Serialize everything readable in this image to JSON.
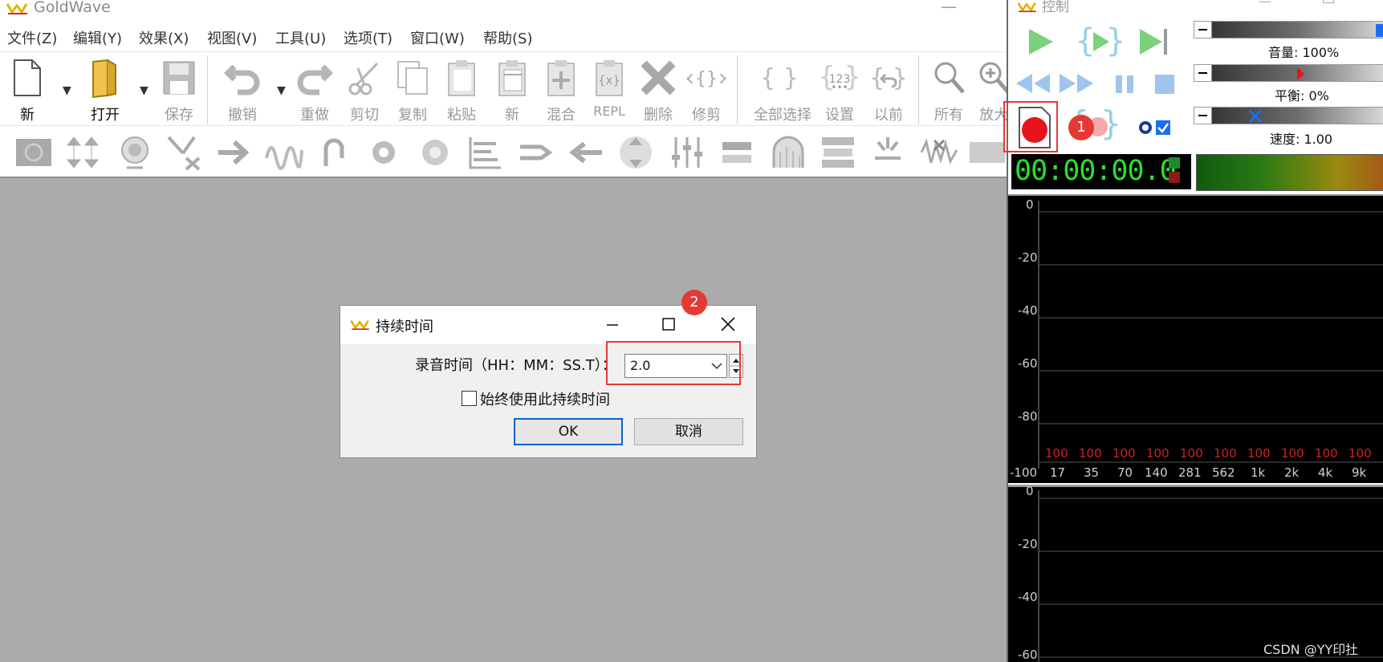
{
  "app": {
    "title": "GoldWave",
    "minimize_glyph": "—"
  },
  "menu": {
    "items": [
      "文件(Z)",
      "编辑(Y)",
      "效果(X)",
      "视图(V)",
      "工具(U)",
      "选项(T)",
      "窗口(W)",
      "帮助(S)"
    ]
  },
  "toolbar": {
    "new": "新",
    "open": "打开",
    "save": "保存",
    "undo": "撤销",
    "redo": "重做",
    "cut": "剪切",
    "copy": "复制",
    "paste": "粘贴",
    "paste_new": "新",
    "mix": "混合",
    "replace": "REPL",
    "delete": "删除",
    "trim": "修剪",
    "select_all": "全部选择",
    "set": "设置",
    "previous": "以前",
    "all": "所有",
    "zoom_in": "放大"
  },
  "dialog": {
    "title": "持续时间",
    "duration_label": "录音时间（HH：MM：SS.T）：",
    "duration_value": "2.0",
    "always_use_label": "始终使用此持续时间",
    "always_use_checked": false,
    "ok_label": "OK",
    "cancel_label": "取消"
  },
  "control": {
    "title": "控制",
    "volume_label": "音量: 100%",
    "volume_value": 1.0,
    "balance_label": "平衡: 0%",
    "balance_value": 0,
    "speed_label": "速度: 1.00",
    "speed_value": 1.0,
    "time_display": "00:00:00.0",
    "spectrum": {
      "db_ticks": [
        "0",
        "-20",
        "-40",
        "-60",
        "-80",
        "-100"
      ],
      "peak_values": [
        "100",
        "100",
        "100",
        "100",
        "100",
        "100",
        "100",
        "100",
        "100",
        "100"
      ],
      "freq_labels": [
        "17",
        "35",
        "70",
        "140",
        "281",
        "562",
        "1k",
        "2k",
        "4k",
        "9k"
      ]
    },
    "spectrum2": {
      "db_ticks": [
        "0",
        "-20",
        "-40",
        "-60"
      ]
    }
  },
  "annotations": {
    "badge1": "1",
    "badge2": "2",
    "highlight_color": "#e53935"
  },
  "watermark": "CSDN @YY印扗",
  "colors": {
    "accent": "#0a64d0",
    "clock_green": "#27e02e",
    "record_red": "#e8141c",
    "play_green": "#7cd17c",
    "peak_red": "#d12020",
    "workspace_gray": "#ababab"
  }
}
